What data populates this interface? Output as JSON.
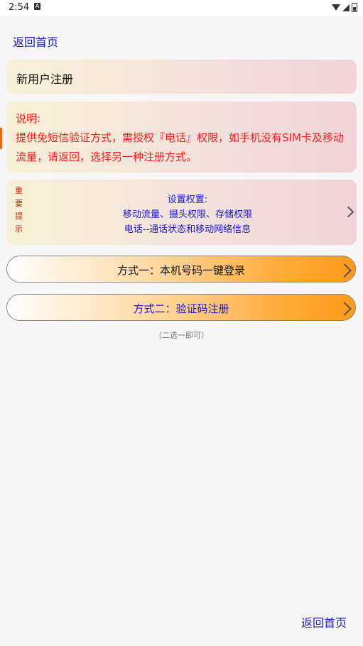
{
  "status_bar": {
    "time": "2:54",
    "notification_icon": "A"
  },
  "nav": {
    "back_home_top": "返回首页",
    "back_home_bottom": "返回首页"
  },
  "title_card": {
    "label": "新用户注册"
  },
  "note_card": {
    "heading": "说明:",
    "body": "提供免短信验证方式，需授权『电话』权限，如手机没有SIM卡及移动流量，请返回，选择另一种注册方式。"
  },
  "permission_card": {
    "side_label": [
      "重",
      "要",
      "提",
      "示"
    ],
    "title": "设置权置:",
    "line1": "移动流量、摄头权限、存储权限",
    "line2": "电话--通话状态和移动网络信息"
  },
  "options": {
    "option1_label": "方式一：本机号码一键登录",
    "option2_label": "方式二：验证码注册",
    "hint": "（二选一即可）"
  },
  "colors": {
    "link": "#1a1ad6",
    "warning": "#ff1a1a",
    "button_gradient_end": "#ff9a1a"
  }
}
